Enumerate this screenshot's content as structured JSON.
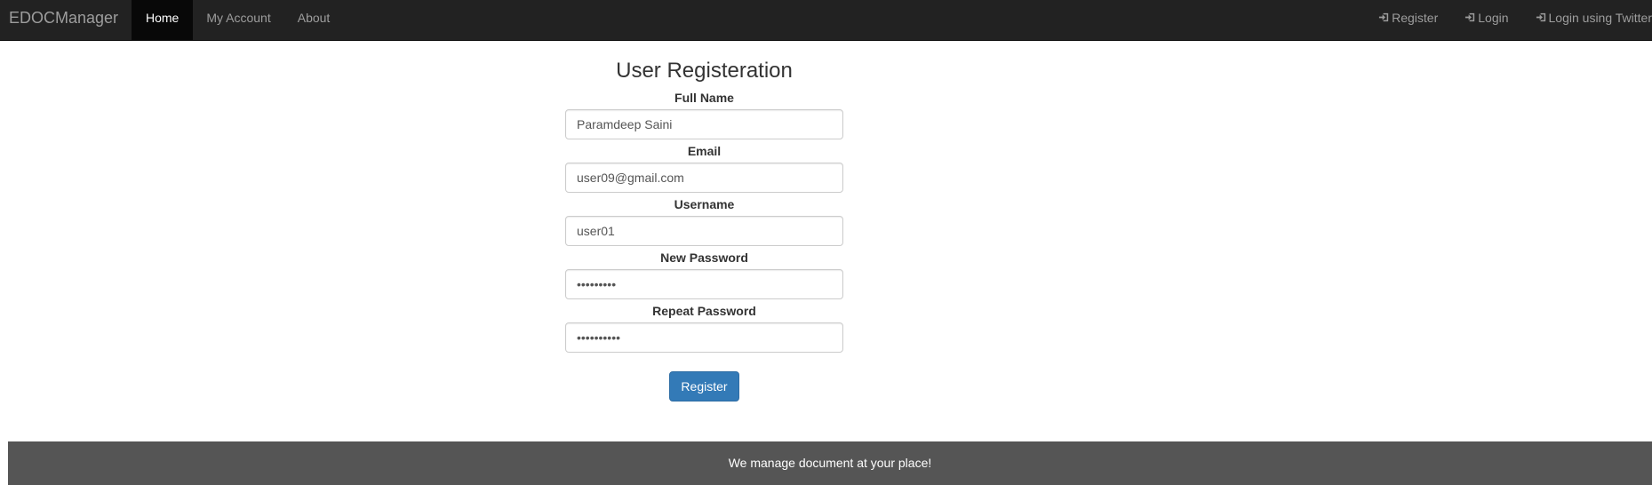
{
  "navbar": {
    "brand": "EDOCManager",
    "left_items": [
      {
        "label": "Home",
        "active": true
      },
      {
        "label": "My Account",
        "active": false
      },
      {
        "label": "About",
        "active": false
      }
    ],
    "right_items": [
      {
        "label": "Register",
        "icon": "log-in-icon"
      },
      {
        "label": "Login",
        "icon": "log-in-icon"
      },
      {
        "label": "Login using Twitter",
        "icon": "log-in-icon"
      }
    ]
  },
  "form": {
    "title": "User Registeration",
    "fields": [
      {
        "label": "Full Name",
        "type": "text",
        "value": "Paramdeep Saini"
      },
      {
        "label": "Email",
        "type": "text",
        "value": "user09@gmail.com"
      },
      {
        "label": "Username",
        "type": "text",
        "value": "user01"
      },
      {
        "label": "New Password",
        "type": "password",
        "value": "123456789"
      },
      {
        "label": "Repeat Password",
        "type": "password",
        "value": "1234567890"
      }
    ],
    "submit_label": "Register"
  },
  "footer": {
    "text": "We manage document at your place!"
  },
  "colors": {
    "navbar_bg": "#222222",
    "nav_active_bg": "#080808",
    "nav_text": "#9d9d9d",
    "primary_button": "#337ab7",
    "footer_bg": "#555555"
  }
}
